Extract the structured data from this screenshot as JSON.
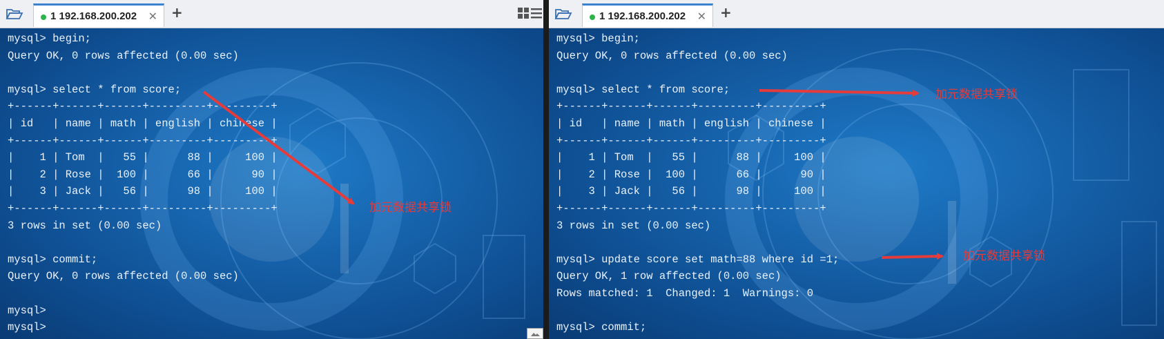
{
  "left": {
    "tab": {
      "label": "1 192.168.200.202"
    },
    "terminal_lines": [
      "mysql> begin;",
      "Query OK, 0 rows affected (0.00 sec)",
      "",
      "mysql> select * from score;",
      "+------+------+------+---------+---------+",
      "| id   | name | math | english | chinese |",
      "+------+------+------+---------+---------+",
      "|    1 | Tom  |   55 |      88 |     100 |",
      "|    2 | Rose |  100 |      66 |      90 |",
      "|    3 | Jack |   56 |      98 |     100 |",
      "+------+------+------+---------+---------+",
      "3 rows in set (0.00 sec)",
      "",
      "mysql> commit;",
      "Query OK, 0 rows affected (0.00 sec)",
      "",
      "mysql>",
      "mysql>"
    ],
    "annotation": "加元数据共享锁"
  },
  "right": {
    "tab": {
      "label": "1 192.168.200.202"
    },
    "terminal_lines": [
      "mysql> begin;",
      "Query OK, 0 rows affected (0.00 sec)",
      "",
      "mysql> select * from score;",
      "+------+------+------+---------+---------+",
      "| id   | name | math | english | chinese |",
      "+------+------+------+---------+---------+",
      "|    1 | Tom  |   55 |      88 |     100 |",
      "|    2 | Rose |  100 |      66 |      90 |",
      "|    3 | Jack |   56 |      98 |     100 |",
      "+------+------+------+---------+---------+",
      "3 rows in set (0.00 sec)",
      "",
      "mysql> update score set math=88 where id =1;",
      "Query OK, 1 row affected (0.00 sec)",
      "Rows matched: 1  Changed: 1  Warnings: 0",
      "",
      "mysql> commit;"
    ],
    "annotation_1": "加元数据共享锁",
    "annotation_2": "加元数据共享锁"
  },
  "icons": {
    "folder": "folder-open-icon",
    "close": "close-icon",
    "new_tab": "plus-icon",
    "grid": "grid-view-icon",
    "menu": "hamburger-menu-icon",
    "status": "connected-dot-icon"
  },
  "colors": {
    "annotation_red": "#e53b3b",
    "terminal_text": "#eaf2fb",
    "tab_accent": "#3a82d0",
    "connected_green": "#2db34a"
  }
}
